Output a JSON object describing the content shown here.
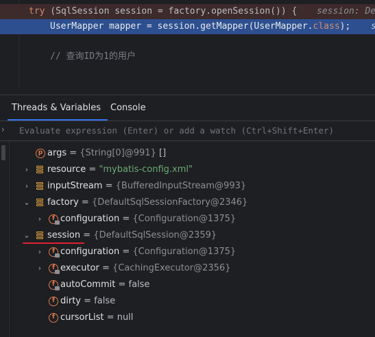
{
  "editor": {
    "line_try": {
      "keyword": "try",
      "code": " (SqlSession session = factory.openSession()) {",
      "hint": "session: De"
    },
    "line_mapper": {
      "code_before": "UserMapper mapper = session.getMapper(UserMapper.",
      "keyword": "class",
      "code_after": ");",
      "hint": "s"
    },
    "line_comment": "// 查询ID为1的用户"
  },
  "tabs": [
    {
      "label": "Threads & Variables",
      "active": true
    },
    {
      "label": "Console",
      "active": false
    }
  ],
  "evaluate": {
    "placeholder": "Evaluate expression (Enter) or add a watch (Ctrl+Shift+Enter)"
  },
  "variables": [
    {
      "name": "args",
      "value": "{String[0]@991}",
      "extra": "[]",
      "icon": "parameter-icon",
      "expandable": false,
      "expanded": false
    },
    {
      "name": "resource",
      "value": "\"mybatis-config.xml\"",
      "icon": "local-variable-icon",
      "expandable": true,
      "expanded": false
    },
    {
      "name": "inputStream",
      "value": "{BufferedInputStream@993}",
      "icon": "local-variable-icon",
      "expandable": true,
      "expanded": false
    },
    {
      "name": "factory",
      "value": "{DefaultSqlSessionFactory@2346}",
      "icon": "local-variable-icon",
      "expandable": true,
      "expanded": true
    },
    {
      "name": "configuration",
      "value": "{Configuration@1375}",
      "icon": "final-field-icon",
      "expandable": true,
      "expanded": false
    },
    {
      "name": "session",
      "value": "{DefaultSqlSession@2359}",
      "icon": "local-variable-icon",
      "expandable": true,
      "expanded": true
    },
    {
      "name": "configuration",
      "value": "{Configuration@1375}",
      "icon": "final-field-icon",
      "expandable": true,
      "expanded": false
    },
    {
      "name": "executor",
      "value": "{CachingExecutor@2356}",
      "icon": "final-field-icon",
      "expandable": true,
      "expanded": false
    },
    {
      "name": "autoCommit",
      "value": "false",
      "icon": "final-field-icon",
      "expandable": false,
      "expanded": false
    },
    {
      "name": "dirty",
      "value": "false",
      "icon": "field-icon",
      "expandable": false,
      "expanded": false
    },
    {
      "name": "cursorList",
      "value": "null",
      "icon": "field-icon",
      "expandable": false,
      "expanded": false
    }
  ],
  "glyphs": {
    "eval_arrow": "›",
    "collapsed": "›",
    "expanded": "⌄",
    "param_letter": "p",
    "field_letter": "f",
    "equals": " = "
  },
  "colors": {
    "background": "#1e1f22",
    "selected_line": "#2d4f8f",
    "keyword": "#cf8e6d",
    "string": "#6aab73",
    "tab_underline": "#3574f0",
    "annotation": "#e0212e"
  }
}
